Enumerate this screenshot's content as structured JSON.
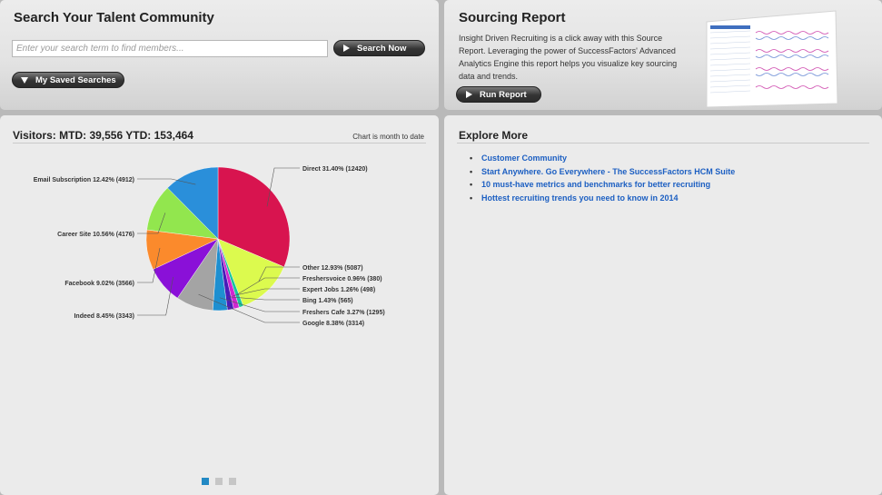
{
  "search_panel": {
    "title": "Search Your Talent Community",
    "input_placeholder": "Enter your search term to find members...",
    "search_button": "Search Now",
    "saved_searches_button": "My Saved Searches"
  },
  "report_panel": {
    "title": "Sourcing Report",
    "description": "Insight Driven Recruiting is a click away with this Source Report. Leveraging the power of SuccessFactors' Advanced Analytics Engine this report helps you visualize key sourcing data and trends.",
    "run_button": "Run Report"
  },
  "visitors_panel": {
    "title": "Visitors: MTD: 39,556  YTD: 153,464",
    "note": "Chart is month to date",
    "pager": {
      "pages": 3,
      "active": 0
    }
  },
  "explore_panel": {
    "title": "Explore More",
    "links": [
      "Customer Community",
      "Start Anywhere. Go Everywhere - The SuccessFactors HCM Suite",
      "10 must-have metrics and benchmarks for better recruiting",
      "Hottest recruiting trends you need to know in 2014"
    ]
  },
  "colors": {
    "link": "#1c5fc2",
    "button_dark": "#2c2c2c",
    "pager_active": "#2289c4"
  },
  "chart_data": {
    "type": "pie",
    "slices": [
      {
        "label": "Direct 31.40% (12420)",
        "value": 12420,
        "color": "#d8144f"
      },
      {
        "label": "Other 12.93% (5087)",
        "value": 5087,
        "color": "#dcfa4e"
      },
      {
        "label": "Freshersvoice 0.96% (380)",
        "value": 380,
        "color": "#17c49c"
      },
      {
        "label": "Expert Jobs 1.26% (498)",
        "value": 498,
        "color": "#d026d0"
      },
      {
        "label": "Bing 1.43% (565)",
        "value": 565,
        "color": "#4a1bb8"
      },
      {
        "label": "Freshers Cafe 3.27% (1295)",
        "value": 1295,
        "color": "#1e8fd0"
      },
      {
        "label": "Google 8.38% (3314)",
        "value": 3314,
        "color": "#a4a4a4"
      },
      {
        "label": "Indeed 8.45% (3343)",
        "value": 3343,
        "color": "#8a10d8"
      },
      {
        "label": "Facebook 9.02% (3566)",
        "value": 3566,
        "color": "#fb8a2c"
      },
      {
        "label": "Career Site 10.56% (4176)",
        "value": 4176,
        "color": "#92e64e"
      },
      {
        "label": "Email Subscription 12.42% (4912)",
        "value": 4912,
        "color": "#2a8fda"
      }
    ]
  }
}
